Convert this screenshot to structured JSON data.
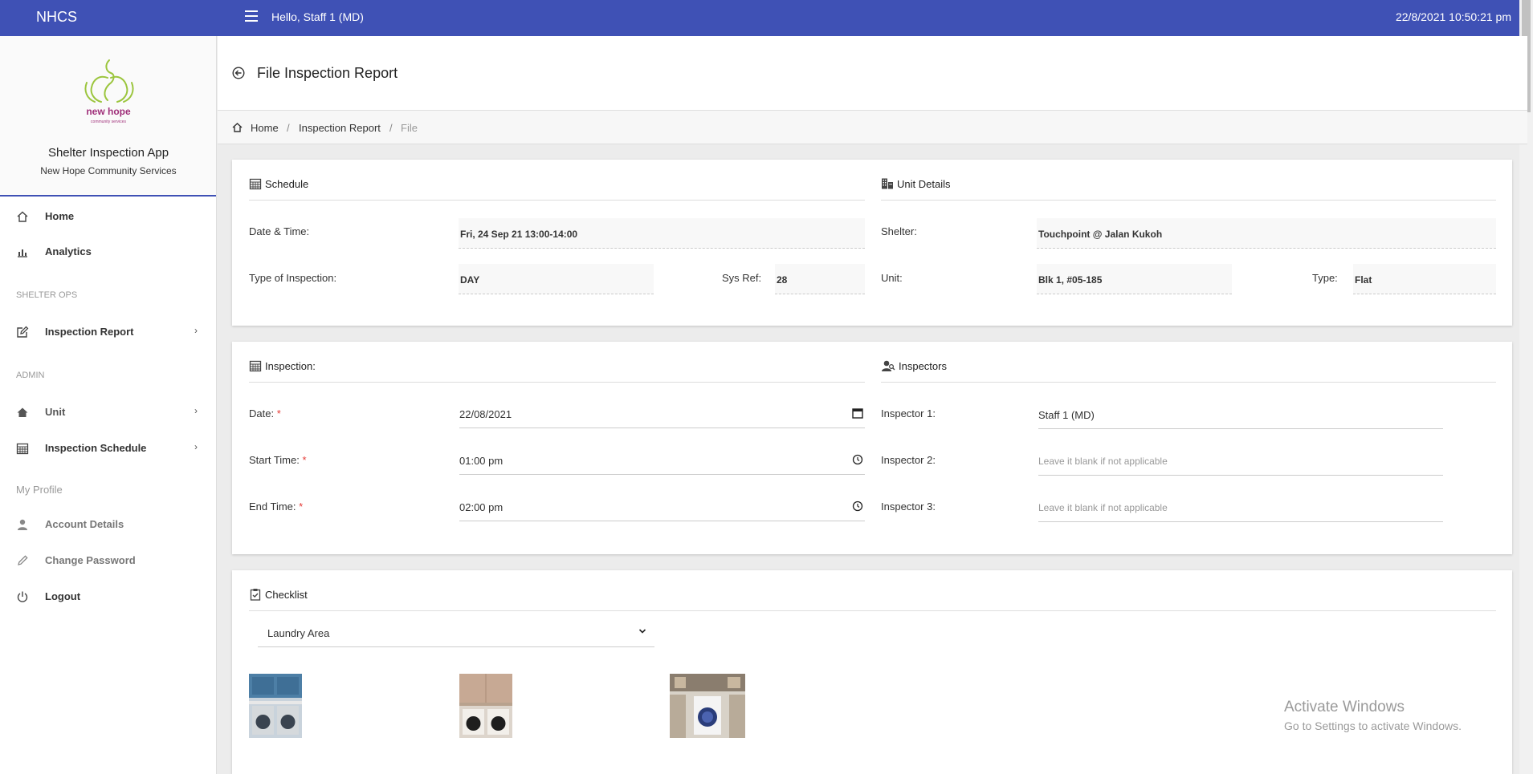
{
  "header": {
    "brand": "NHCS",
    "greeting": "Hello, Staff 1 (MD)",
    "datetime": "22/8/2021 10:50:21 pm"
  },
  "sidebar": {
    "logo_text": "new hope",
    "logo_subtext": "community services",
    "app_title": "Shelter Inspection App",
    "org_title": "New Hope Community Services",
    "items": [
      {
        "label": "Home",
        "icon": "home-icon"
      },
      {
        "label": "Analytics",
        "icon": "bar-chart-icon"
      },
      {
        "label": "Inspection Report",
        "icon": "edit-icon"
      },
      {
        "label": "Unit",
        "icon": "home-icon"
      },
      {
        "label": "Inspection Schedule",
        "icon": "calendar-icon"
      },
      {
        "label": "Account Details",
        "icon": "user-icon"
      },
      {
        "label": "Change Password",
        "icon": "pencil-icon"
      },
      {
        "label": "Logout",
        "icon": "power-icon"
      }
    ],
    "sections": {
      "ops": "SHELTER OPS",
      "admin": "ADMIN",
      "profile": "My Profile"
    }
  },
  "page": {
    "title": "File Inspection Report",
    "breadcrumb": [
      "Home",
      "Inspection Report",
      "File"
    ]
  },
  "schedule": {
    "title": "Schedule",
    "datetime_label": "Date & Time:",
    "datetime_value": "Fri, 24 Sep 21 13:00-14:00",
    "type_label": "Type of Inspection:",
    "type_value": "DAY",
    "sysref_label": "Sys Ref:",
    "sysref_value": "28"
  },
  "unit_details": {
    "title": "Unit Details",
    "shelter_label": "Shelter:",
    "shelter_value": "Touchpoint @ Jalan Kukoh",
    "unit_label": "Unit:",
    "unit_value": "Blk 1, #05-185",
    "type_label": "Type:",
    "type_value": "Flat"
  },
  "inspection": {
    "title": "Inspection:",
    "date_label": "Date:",
    "date_value": "22/08/2021",
    "start_label": "Start Time:",
    "start_value": "01:00 pm",
    "end_label": "End Time:",
    "end_value": "02:00 pm",
    "required_mark": "*"
  },
  "inspectors": {
    "title": "Inspectors",
    "i1_label": "Inspector 1:",
    "i1_value": "Staff 1 (MD)",
    "i2_label": "Inspector 2:",
    "i2_placeholder": "Leave it blank if not applicable",
    "i3_label": "Inspector 3:",
    "i3_placeholder": "Leave it blank if not applicable"
  },
  "checklist": {
    "title": "Checklist",
    "area_selected": "Laundry Area"
  },
  "watermark": {
    "line1": "Activate Windows",
    "line2": "Go to Settings to activate Windows."
  },
  "colors": {
    "primary": "#3f51b5",
    "required": "#e53935"
  }
}
